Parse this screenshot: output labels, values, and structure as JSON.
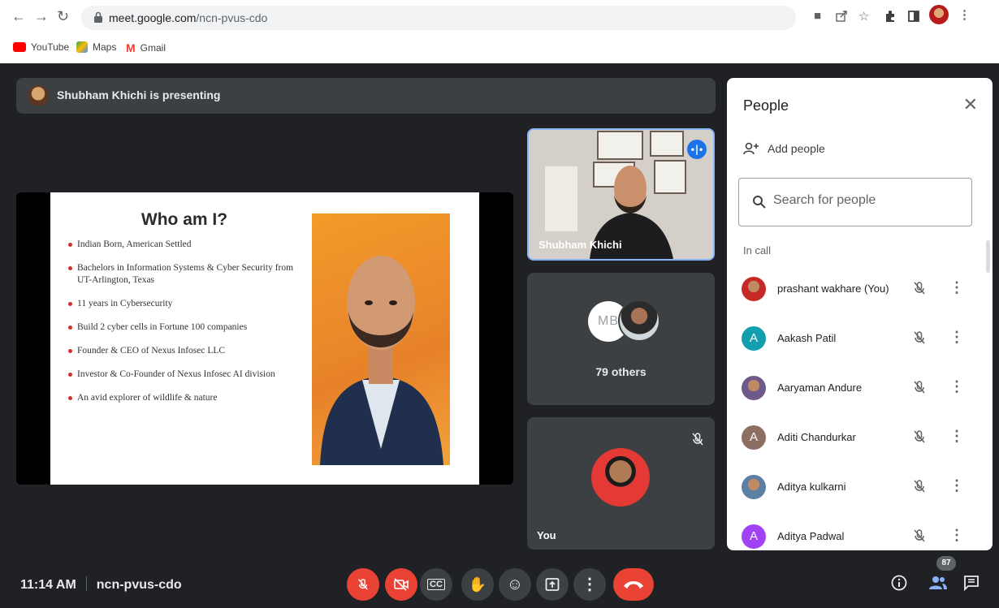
{
  "browser": {
    "url_host": "meet.google.com",
    "url_path": "/ncn-pvus-cdo",
    "nav": {
      "back_icon": "arrow-back-icon",
      "forward_icon": "arrow-forward-icon",
      "reload_icon": "reload-icon"
    },
    "toolbar_icons": [
      "camera-icon",
      "share-icon",
      "star-icon",
      "extensions-icon",
      "sidepanel-icon",
      "profile-avatar",
      "menu-icon"
    ],
    "bookmarks": [
      {
        "label": "YouTube",
        "color": "#ff0000"
      },
      {
        "label": "Maps",
        "color": "#34a853"
      },
      {
        "label": "Gmail",
        "color": "#ea4335"
      }
    ]
  },
  "meet": {
    "presenting_banner": "Shubham Khichi is presenting",
    "slide": {
      "title": "Who am I?",
      "bullets": [
        "Indian Born, American Settled",
        "Bachelors in Information Systems & Cyber Security from UT-Arlington, Texas",
        "11 years in Cybersecurity",
        "Build 2 cyber cells in Fortune 100 companies",
        "Founder & CEO of Nexus Infosec LLC",
        "Investor & Co-Founder of Nexus Infosec AI division",
        "An avid explorer of wildlife & nature"
      ]
    },
    "tiles": {
      "presenter_name": "Shubham Khichi",
      "others_label": "79 others",
      "others_logo_text": "MB",
      "you_label": "You"
    },
    "bottom": {
      "time": "11:14 AM",
      "meeting_code": "ncn-pvus-cdo",
      "people_count": "87"
    }
  },
  "people_panel": {
    "title": "People",
    "add_people": "Add people",
    "search_placeholder": "Search for people",
    "section": "In call",
    "participants": [
      {
        "name": "prashant wakhare (You)",
        "initial": "",
        "color": "#c62828",
        "photo": true
      },
      {
        "name": "Aakash Patil",
        "initial": "A",
        "color": "#129eaf",
        "photo": false
      },
      {
        "name": "Aaryaman Andure",
        "initial": "",
        "color": "#6d5a8a",
        "photo": true
      },
      {
        "name": "Aditi Chandurkar",
        "initial": "A",
        "color": "#8d6e63",
        "photo": false
      },
      {
        "name": "Aditya kulkarni",
        "initial": "",
        "color": "#5c7fa3",
        "photo": true
      },
      {
        "name": "Aditya Padwal",
        "initial": "A",
        "color": "#a142f4",
        "photo": false
      }
    ]
  },
  "colors": {
    "accent": "#1a73e8",
    "danger": "#ea4335",
    "surface": "#3c4043",
    "background": "#202124"
  }
}
